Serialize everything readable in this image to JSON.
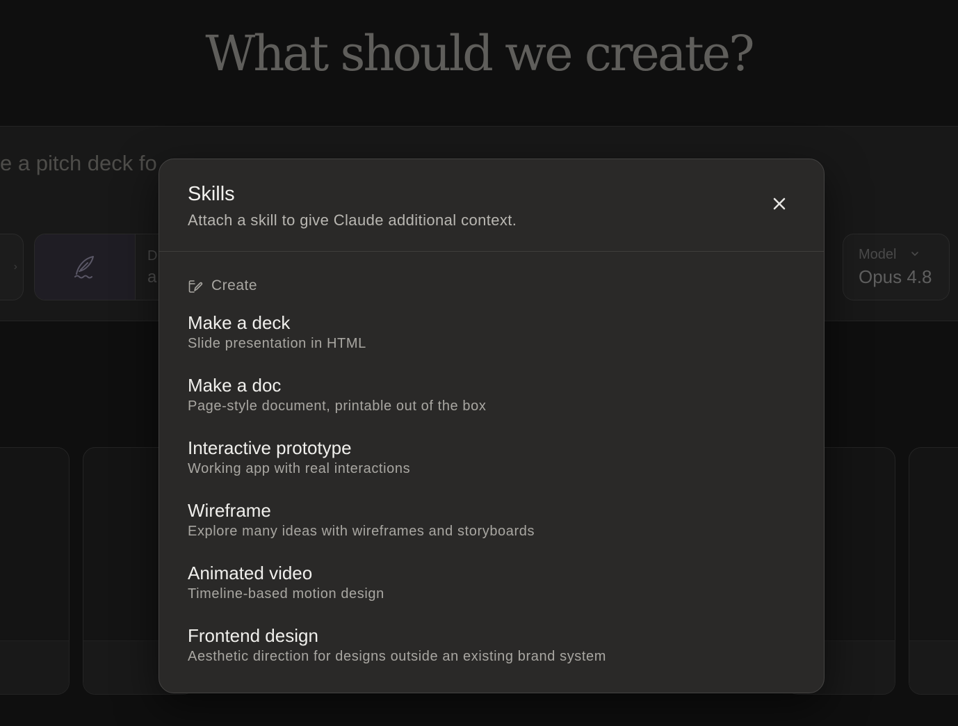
{
  "background": {
    "hero_title": "What should we create?",
    "prompt_text": "e a pitch deck fo",
    "left_chip_glyph": "›",
    "design_chip": {
      "icon": "quill-icon",
      "label": "D",
      "value": "a"
    },
    "model_chip": {
      "label": "Model",
      "value": "Opus 4.8",
      "caret_icon": "chevron-down-icon"
    }
  },
  "modal": {
    "title": "Skills",
    "subtitle": "Attach a skill to give Claude additional context.",
    "close_icon": "close-icon",
    "section": {
      "icon": "edit-pen-icon",
      "label": "Create"
    },
    "items": [
      {
        "name": "Make a deck",
        "description": "Slide presentation in HTML"
      },
      {
        "name": "Make a doc",
        "description": "Page-style document, printable out of the box"
      },
      {
        "name": "Interactive prototype",
        "description": "Working app with real interactions"
      },
      {
        "name": "Wireframe",
        "description": "Explore many ideas with wireframes and storyboards"
      },
      {
        "name": "Animated video",
        "description": "Timeline-based motion design"
      },
      {
        "name": "Frontend design",
        "description": "Aesthetic direction for designs outside an existing brand system"
      }
    ]
  },
  "colors": {
    "page_background": "#0f0f0f",
    "modal_background": "#2a2928",
    "modal_border": "#454443",
    "primary_text": "#f0efec",
    "secondary_text": "#a9a7a2"
  }
}
